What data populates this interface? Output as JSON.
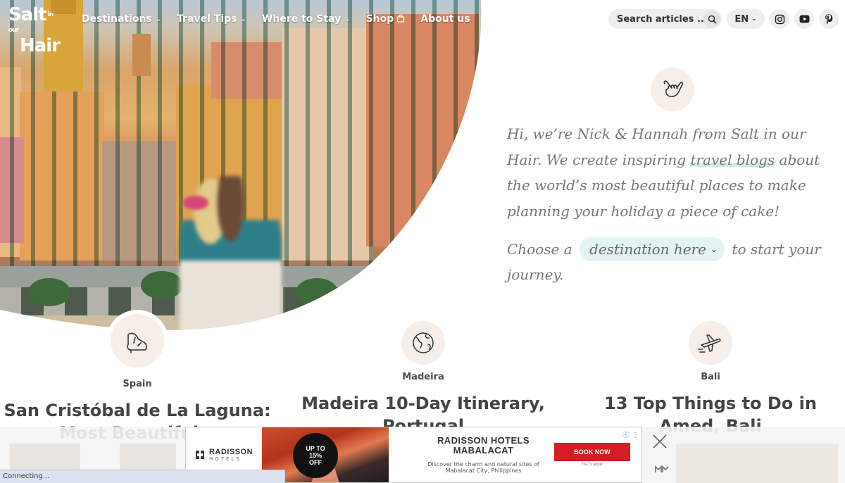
{
  "logo": {
    "line1": "Salt",
    "line1_small": "in our",
    "line2": "Hair"
  },
  "nav": {
    "items": [
      {
        "label": "Destinations",
        "has_dropdown": true
      },
      {
        "label": "Travel Tips",
        "has_dropdown": true
      },
      {
        "label": "Where to Stay",
        "has_dropdown": true
      },
      {
        "label": "Shop",
        "has_dropdown": false,
        "icon": "shopping-bag-icon"
      },
      {
        "label": "About us",
        "has_dropdown": false
      }
    ]
  },
  "search": {
    "placeholder": "Search articles ...",
    "icon": "search-icon"
  },
  "language": {
    "value": "EN"
  },
  "social": [
    {
      "name": "instagram",
      "icon": "instagram-icon"
    },
    {
      "name": "youtube",
      "icon": "youtube-icon"
    },
    {
      "name": "pinterest",
      "icon": "pinterest-icon"
    }
  ],
  "intro": {
    "icon": "shaka-hand-icon",
    "text_before": "Hi, we’re Nick & Hannah from Salt in our Hair. We create inspiring ",
    "highlight": "travel blogs",
    "text_after": " about the world’s most beautiful places to make planning your holiday a piece of cake!",
    "choose_prefix": "Choose a",
    "destination_select": "destination here",
    "choose_suffix": "to start your journey."
  },
  "cards": [
    {
      "category": "Spain",
      "title": "San Cristóbal de La Laguna: Most Beautiful…",
      "icon": "flamenco-shoe-icon"
    },
    {
      "category": "Madeira",
      "title": "Madeira 10-Day Itinerary, Portugal",
      "icon": "globe-icon"
    },
    {
      "category": "Bali",
      "title": "13 Top Things to Do in Amed, Bali",
      "icon": "airplane-icon"
    }
  ],
  "ad": {
    "brand": "RADISSON",
    "brand_sub": "HOTELS",
    "discount_line1": "UP TO",
    "discount_line2": "15%",
    "discount_line3": "OFF",
    "headline_line1": "RADISSON HOTELS",
    "headline_line2": "MABALACAT",
    "subtext": "Discover the charm and natural sites of Mabalacat City, Philippines",
    "cta": "BOOK NOW",
    "terms": "T&C's apply",
    "colors": {
      "cta": "#d41d24"
    }
  },
  "status_bar": {
    "text": "Connecting..."
  },
  "colors": {
    "highlight": "#cfeaea",
    "pill": "#e3f3f2",
    "badge": "#f6efe9",
    "text_muted": "#777777"
  }
}
